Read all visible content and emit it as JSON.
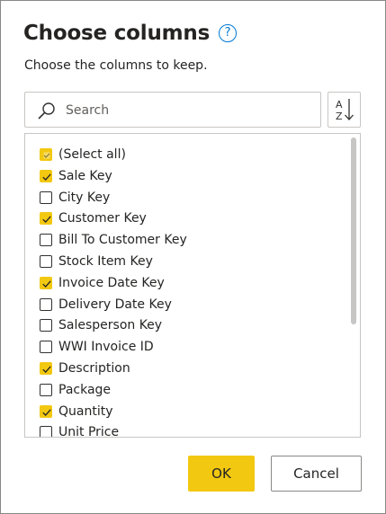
{
  "dialog": {
    "title": "Choose columns",
    "help_icon": "question-circle-icon",
    "subtitle": "Choose the columns to keep."
  },
  "search": {
    "placeholder": "Search",
    "icon": "search-icon"
  },
  "sort_button": {
    "icon": "sort-a-z-icon"
  },
  "columns": [
    {
      "label": "(Select all)",
      "state": "partial"
    },
    {
      "label": "Sale Key",
      "state": "checked"
    },
    {
      "label": "City Key",
      "state": "unchecked"
    },
    {
      "label": "Customer Key",
      "state": "checked"
    },
    {
      "label": "Bill To Customer Key",
      "state": "unchecked"
    },
    {
      "label": "Stock Item Key",
      "state": "unchecked"
    },
    {
      "label": "Invoice Date Key",
      "state": "checked"
    },
    {
      "label": "Delivery Date Key",
      "state": "unchecked"
    },
    {
      "label": "Salesperson Key",
      "state": "unchecked"
    },
    {
      "label": "WWI Invoice ID",
      "state": "unchecked"
    },
    {
      "label": "Description",
      "state": "checked"
    },
    {
      "label": "Package",
      "state": "unchecked"
    },
    {
      "label": "Quantity",
      "state": "checked"
    },
    {
      "label": "Unit Price",
      "state": "unchecked"
    }
  ],
  "buttons": {
    "ok": "OK",
    "cancel": "Cancel"
  },
  "colors": {
    "accent": "#f2c811",
    "help": "#0078d4",
    "border": "#c8c6c4"
  }
}
